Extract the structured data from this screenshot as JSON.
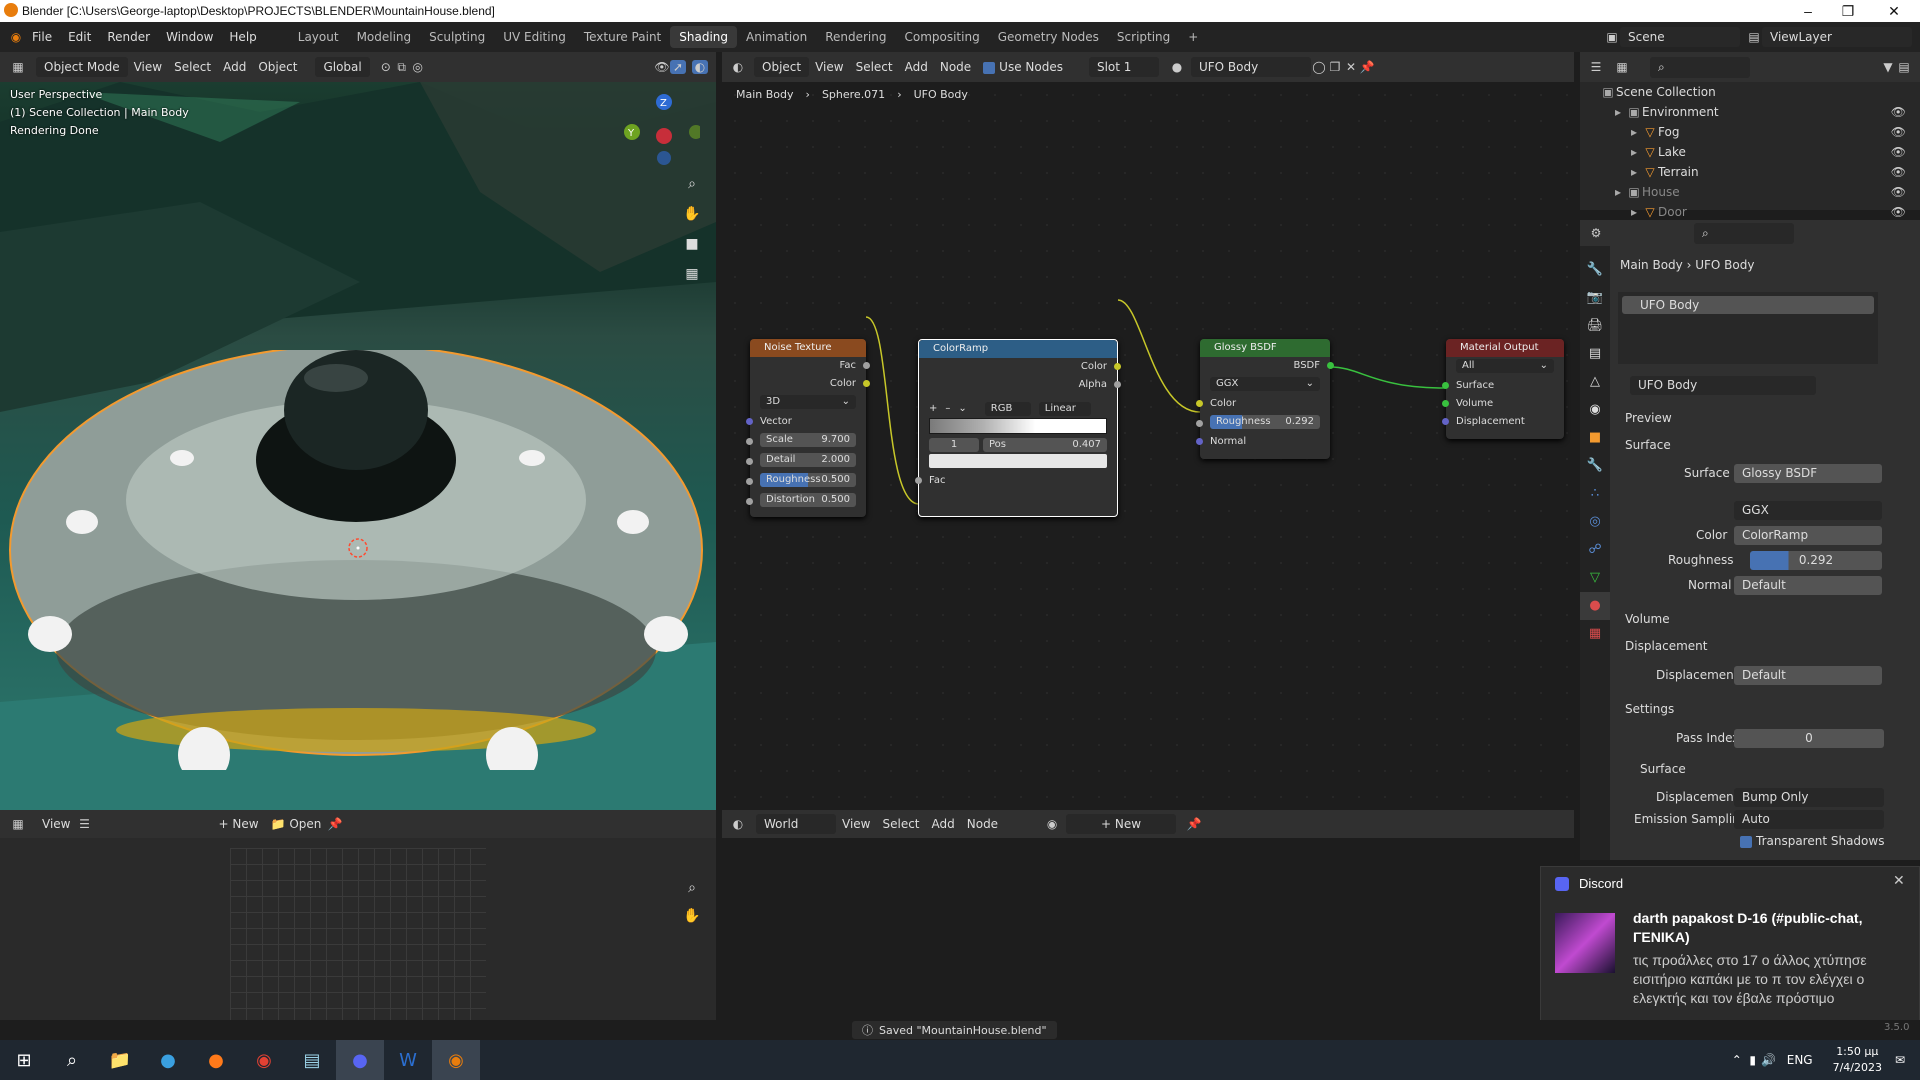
{
  "window": {
    "title": "Blender [C:\\Users\\George-laptop\\Desktop\\PROJECTS\\BLENDER\\MountainHouse.blend]"
  },
  "menu": {
    "items": [
      "File",
      "Edit",
      "Render",
      "Window",
      "Help"
    ]
  },
  "workspaces": [
    "Layout",
    "Modeling",
    "Sculpting",
    "UV Editing",
    "Texture Paint",
    "Shading",
    "Animation",
    "Rendering",
    "Compositing",
    "Geometry Nodes",
    "Scripting"
  ],
  "active_workspace": "Shading",
  "top_right": {
    "scene": "Scene",
    "view_layer": "ViewLayer"
  },
  "viewport": {
    "mode": "Object Mode",
    "menus": [
      "View",
      "Select",
      "Add",
      "Object"
    ],
    "transform": "Global",
    "overlay_lines": [
      "User Perspective",
      "(1) Scene Collection | Main Body",
      "Rendering Done"
    ]
  },
  "node_editor": {
    "object_dropdown": "Object",
    "menus": [
      "View",
      "Select",
      "Add",
      "Node"
    ],
    "use_nodes": "Use Nodes",
    "slot": "Slot 1",
    "material": "UFO Body",
    "breadcrumb": [
      "Main Body",
      "Sphere.071",
      "UFO Body"
    ],
    "noise": {
      "title": "Noise Texture",
      "out_fac": "Fac",
      "out_color": "Color",
      "dim": "3D",
      "vector": "Vector",
      "fields": [
        {
          "label": "Scale",
          "value": "9.700"
        },
        {
          "label": "Detail",
          "value": "2.000"
        },
        {
          "label": "Roughness",
          "value": "0.500"
        },
        {
          "label": "Distortion",
          "value": "0.500"
        }
      ]
    },
    "ramp": {
      "title": "ColorRamp",
      "out_color": "Color",
      "out_alpha": "Alpha",
      "mode": "RGB",
      "interp": "Linear",
      "index": "1",
      "pos_label": "Pos",
      "pos_value": "0.407",
      "in_fac": "Fac"
    },
    "glossy": {
      "title": "Glossy BSDF",
      "out": "BSDF",
      "dist": "GGX",
      "color": "Color",
      "rough_label": "Roughness",
      "rough_value": "0.292",
      "normal": "Normal"
    },
    "output": {
      "title": "Material Output",
      "target": "All",
      "surface": "Surface",
      "volume": "Volume",
      "displacement": "Displacement"
    }
  },
  "outliner": {
    "root": "Scene Collection",
    "rows": [
      {
        "label": "Environment",
        "depth": 1
      },
      {
        "label": "Fog",
        "depth": 2
      },
      {
        "label": "Lake",
        "depth": 2
      },
      {
        "label": "Terrain",
        "depth": 2
      },
      {
        "label": "House",
        "depth": 1
      },
      {
        "label": "Door",
        "depth": 2
      }
    ]
  },
  "properties": {
    "breadcrumb": [
      "Main Body",
      "UFO Body"
    ],
    "slot_item": "UFO Body",
    "material_name": "UFO Body",
    "preview": "Preview",
    "surface_section": "Surface",
    "surface_label": "Surface",
    "surface_value": "Glossy BSDF",
    "dist_value": "GGX",
    "color_label": "Color",
    "color_value": "ColorRamp",
    "rough_label": "Roughness",
    "rough_value": "0.292",
    "rough_fill": 0.292,
    "normal_label": "Normal",
    "normal_value": "Default",
    "volume": "Volume",
    "displacement_section": "Displacement",
    "disp_label": "Displacement",
    "disp_value": "Default",
    "settings": "Settings",
    "pass_label": "Pass Index",
    "pass_value": "0",
    "sub_surface": "Surface",
    "disp_method_label": "Displacement",
    "disp_method": "Bump Only",
    "emission_label": "Emission Sampling",
    "emission_value": "Auto",
    "transparent_shadows": "Transparent Shadows"
  },
  "image_editor": {
    "view": "View",
    "new": "New",
    "open": "Open"
  },
  "world_editor": {
    "world": "World",
    "menus": [
      "View",
      "Select",
      "Add",
      "Node"
    ],
    "new": "New"
  },
  "status": {
    "message": "Saved \"MountainHouse.blend\"",
    "version": "3.5.0"
  },
  "discord": {
    "app": "Discord",
    "title": "darth papakost D-16 (#public-chat, ΓΕΝΙΚΑ)",
    "body": "τις προάλλες στο 17 ο άλλος χτύπησε εισιτήριο καπάκι με το π τον ελέγχει ο ελεγκτής και τον έβαλε πρόστιμο"
  },
  "taskbar": {
    "lang": "ENG",
    "time": "1:50 μμ",
    "date": "7/4/2023"
  },
  "colors": {
    "accent_blue": "#4772b3",
    "noise_header": "#8a4a1f",
    "ramp_header": "#2d5e86",
    "glossy_header": "#2e6b30",
    "output_header": "#6b2323"
  }
}
